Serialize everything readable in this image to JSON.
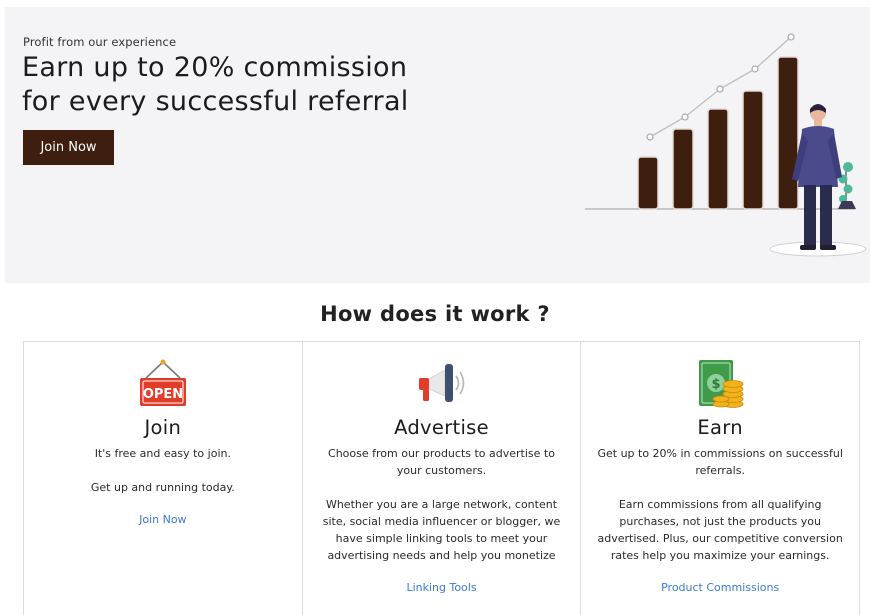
{
  "hero": {
    "eyebrow": "Profit from our experience",
    "title_line1": "Earn up to 20% commission",
    "title_line2": "for every successful referral",
    "cta_label": "Join Now"
  },
  "how_it_works": {
    "title": "How does it work ?",
    "cards": [
      {
        "icon": "open-sign-icon",
        "title": "Join",
        "paragraphs": [
          "It's free and easy to join.",
          "Get up and running today."
        ],
        "link_label": "Join Now"
      },
      {
        "icon": "megaphone-icon",
        "title": "Advertise",
        "paragraphs": [
          "Choose from our products to advertise to your customers.",
          "Whether you are a large network, content site, social media influencer or blogger, we have simple linking tools to meet your advertising needs and help you monetize"
        ],
        "link_label": "Linking Tools"
      },
      {
        "icon": "money-coins-icon",
        "title": "Earn",
        "paragraphs": [
          "Get up to 20% in commissions on successful referrals.",
          "Earn commissions from all qualifying purchases, not just the products you advertised. Plus, our competitive conversion rates help you maximize your earnings."
        ],
        "link_label": "Product Commissions"
      }
    ]
  },
  "colors": {
    "brand_dark": "#3d1e0f",
    "link": "#3a7bd5",
    "hero_bg": "#f4f4f6"
  }
}
